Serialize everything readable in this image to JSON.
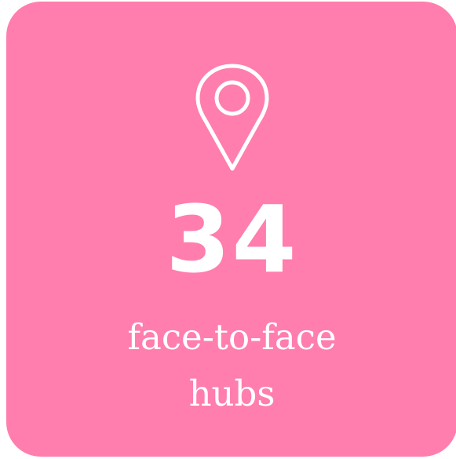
{
  "card": {
    "background_color": "#ff7eae",
    "icon": "map-pin-icon",
    "stat_value": "34",
    "label_line1": "face-to-face",
    "label_line2": "hubs",
    "text_color": "#ffffff"
  }
}
